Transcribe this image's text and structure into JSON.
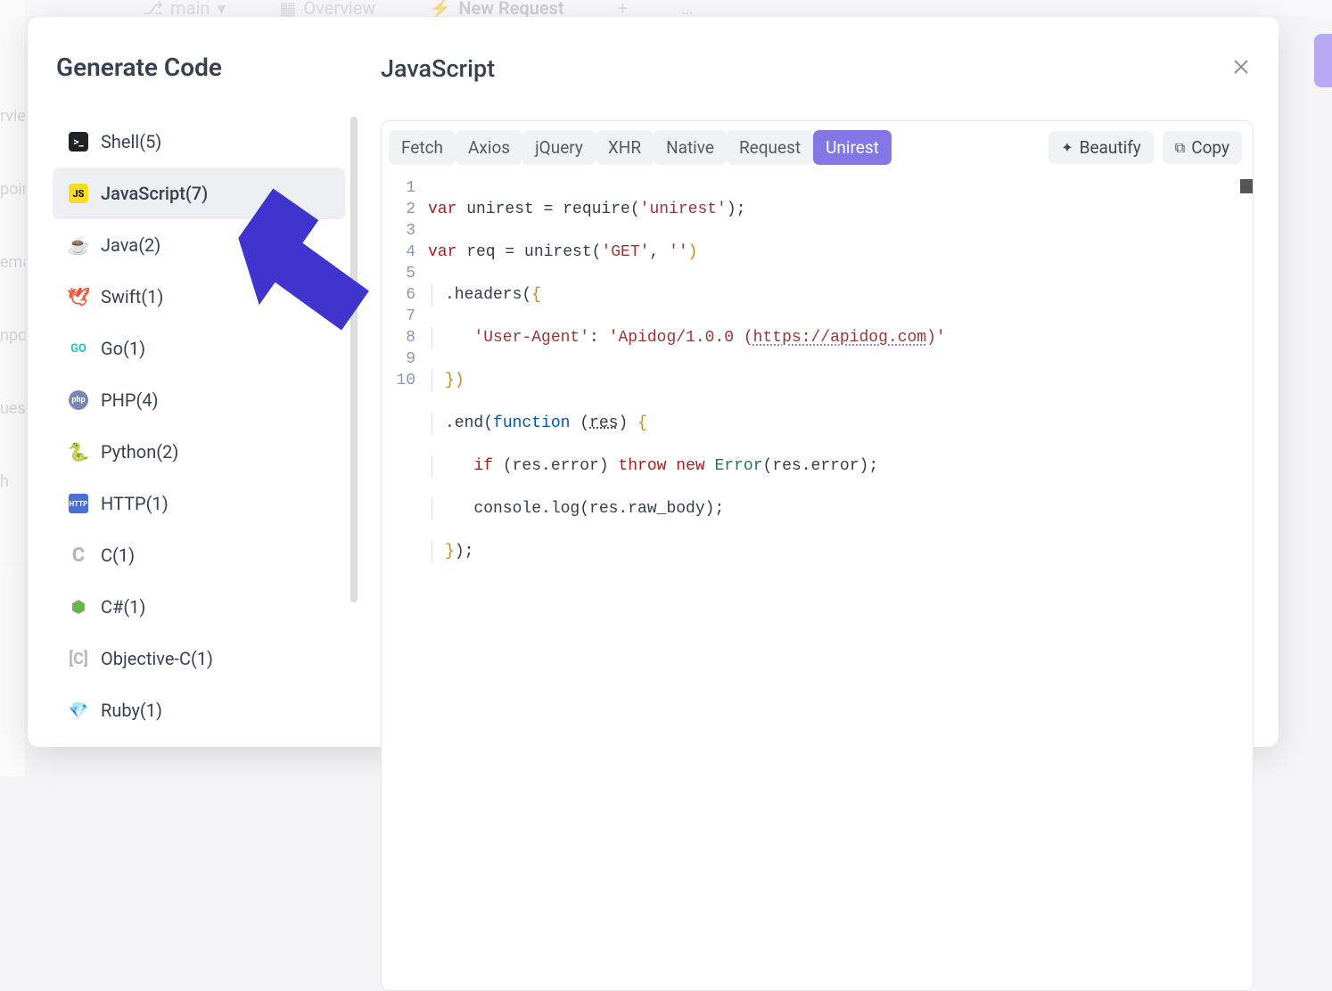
{
  "bg": {
    "branch": "main",
    "overview": "Overview",
    "new_request": "New Request"
  },
  "sidebar": {
    "title": "Generate Code",
    "items": [
      {
        "label": "Shell(5)",
        "icon": "shell-icon"
      },
      {
        "label": "JavaScript(7)",
        "icon": "javascript-icon",
        "selected": true
      },
      {
        "label": "Java(2)",
        "icon": "java-icon"
      },
      {
        "label": "Swift(1)",
        "icon": "swift-icon"
      },
      {
        "label": "Go(1)",
        "icon": "go-icon"
      },
      {
        "label": "PHP(4)",
        "icon": "php-icon"
      },
      {
        "label": "Python(2)",
        "icon": "python-icon"
      },
      {
        "label": "HTTP(1)",
        "icon": "http-icon"
      },
      {
        "label": "C(1)",
        "icon": "c-icon"
      },
      {
        "label": "C#(1)",
        "icon": "csharp-icon"
      },
      {
        "label": "Objective-C(1)",
        "icon": "objectivec-icon"
      },
      {
        "label": "Ruby(1)",
        "icon": "ruby-icon"
      }
    ]
  },
  "panel": {
    "title": "JavaScript",
    "tabs": [
      "Fetch",
      "Axios",
      "jQuery",
      "XHR",
      "Native",
      "Request",
      "Unirest"
    ],
    "active_tab": "Unirest",
    "beautify": "Beautify",
    "copy": "Copy"
  },
  "code": {
    "line_numbers": [
      "1",
      "2",
      "3",
      "4",
      "5",
      "6",
      "7",
      "8",
      "9",
      "10"
    ],
    "tokens": {
      "var1": "var",
      "l1a": " unirest = require(",
      "l1b": "'unirest'",
      "l1c": ");",
      "var2": "var",
      "l2a": " req = unirest(",
      "l2b": "'GET'",
      "l2c": ", ",
      "l2d": "''",
      "l2e": ")",
      "l3a": ".headers(",
      "l3b": "{",
      "l4a": "'User-Agent'",
      "l4b": ": ",
      "l4c": "'Apidog/1.0.0 (",
      "l4link": "https://apidog.com",
      "l4d": ")'",
      "l5a": "}",
      "l5b": ")",
      "l6a": ".end(",
      "l6fn": "function",
      "l6b": " (",
      "l6c": "res",
      "l6d": ") ",
      "l6e": "{",
      "l7a": "if",
      "l7b": " (res.error) ",
      "l7c": "throw",
      "l7d": " ",
      "l7e": "new",
      "l7f": " ",
      "l7g": "Error",
      "l7h": "(res.error);",
      "l8a": "console.log(res.raw_body);",
      "l9a": "}",
      "l9b": ");"
    }
  }
}
